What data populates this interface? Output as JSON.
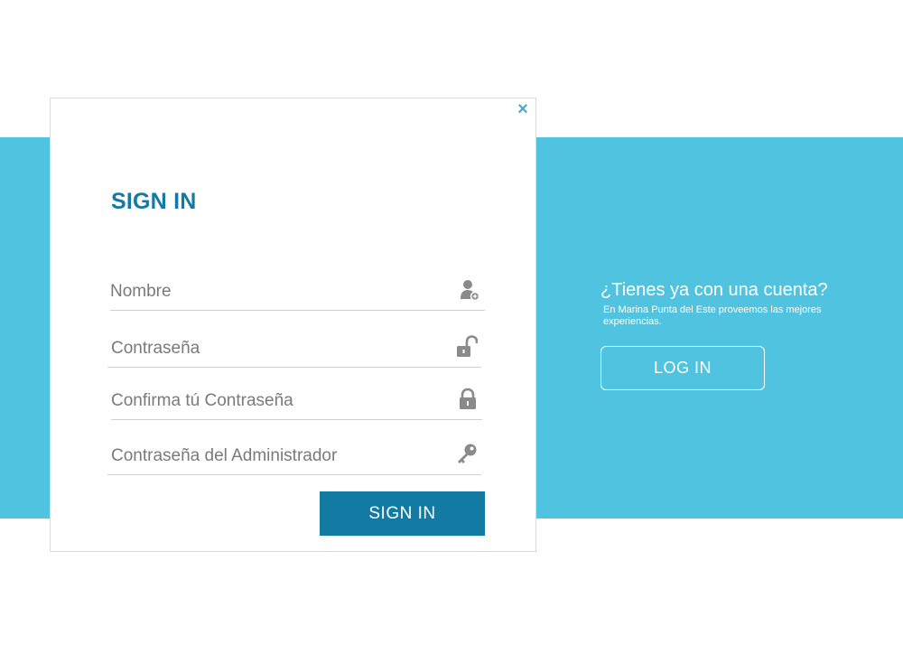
{
  "signin_panel": {
    "close_glyph": "×",
    "title": "SIGN IN",
    "fields": [
      {
        "placeholder": "Nombre",
        "icon": "user-add-icon"
      },
      {
        "placeholder": "Contraseña",
        "icon": "unlock-icon"
      },
      {
        "placeholder": "Confirma tú Contraseña",
        "icon": "lock-icon"
      },
      {
        "placeholder": "Contraseña del Administrador",
        "icon": "key-icon"
      }
    ],
    "submit_label": "SIGN IN"
  },
  "login_panel": {
    "heading": "¿Tienes ya con una cuenta?",
    "description": "En Marina Punta del Este proveemos las mejores experiencias.",
    "button_label": "LOG IN"
  },
  "colors": {
    "band": "#4fc3df",
    "primary": "#137aa3",
    "close": "#4fa7c7",
    "icon": "#8a8a8a",
    "underline": "#cfcfcf"
  }
}
